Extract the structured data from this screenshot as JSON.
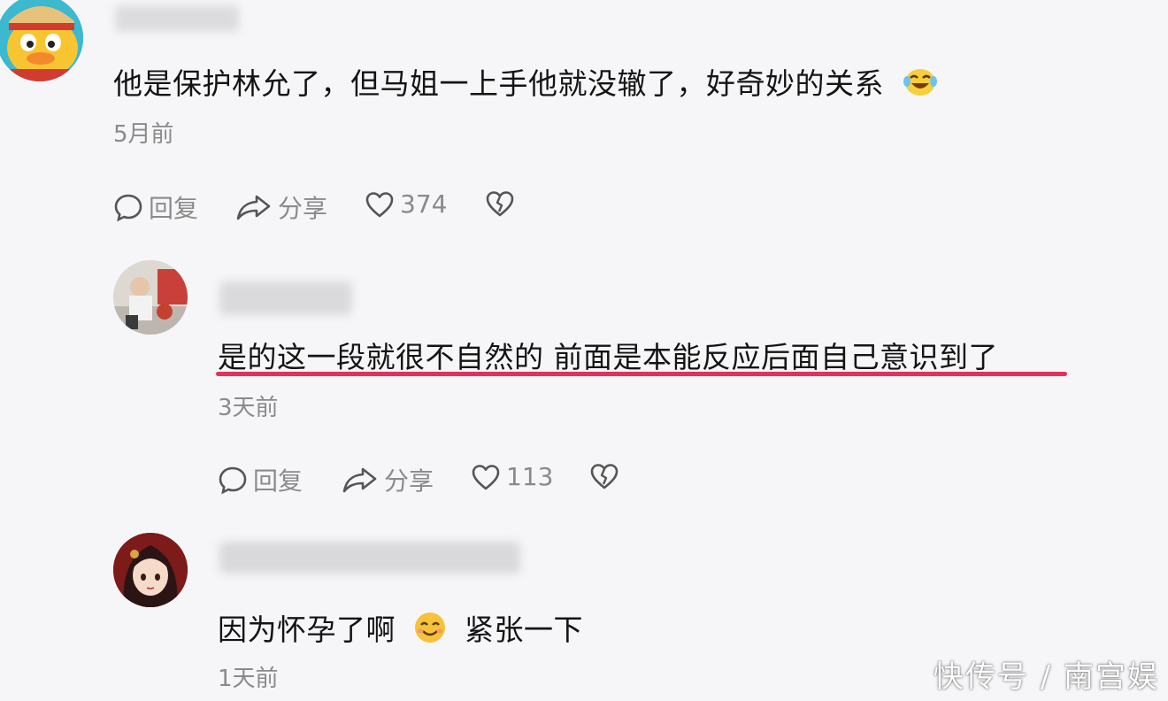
{
  "comments": [
    {
      "text": "他是保护林允了，但马姐一上手他就没辙了，好奇妙的关系",
      "emoji": "laughing-tears-emoji",
      "time": "5月前",
      "actions": {
        "reply": "回复",
        "share": "分享",
        "likes": "374"
      }
    },
    {
      "text": "是的这一段就很不自然的 前面是本能反应后面自己意识到了",
      "time": "3天前",
      "actions": {
        "reply": "回复",
        "share": "分享",
        "likes": "113"
      },
      "underline_color": "#e0325a"
    },
    {
      "text_before": "因为怀孕了啊",
      "emoji": "smiling-face-emoji",
      "text_after": "紧张一下",
      "time": "1天前"
    }
  ],
  "watermark": "快传号 / 南宫娱",
  "colors": {
    "background": "#f6f6f8",
    "meta_gray": "#8a8a8a",
    "underline": "#e0325a"
  }
}
